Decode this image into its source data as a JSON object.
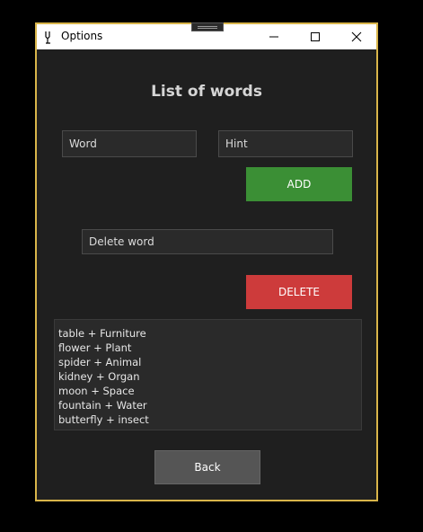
{
  "window": {
    "title": "Options",
    "icon": "tuning-fork-icon"
  },
  "colors": {
    "window_border": "#d9b54a",
    "background": "#1f1f1f",
    "add": "#3b8f35",
    "delete": "#cd3b3b",
    "back": "#555555"
  },
  "main": {
    "heading": "List of words",
    "word_placeholder": "Word",
    "hint_placeholder": "Hint",
    "add_label": "ADD",
    "delete_placeholder": "Delete word",
    "delete_label": "DELETE",
    "words": [
      "table + Furniture",
      "flower + Plant",
      "spider + Animal",
      "kidney + Organ",
      "moon + Space",
      "fountain + Water",
      "butterfly + insect"
    ],
    "back_label": "Back"
  }
}
